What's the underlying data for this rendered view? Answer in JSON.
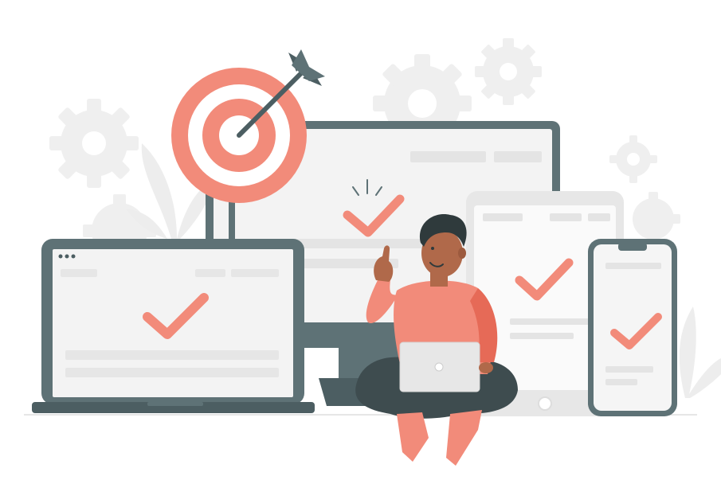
{
  "illustration": {
    "subject": "responsive-design-success",
    "colors": {
      "accent": "#F28B7A",
      "accent_dark": "#E66A57",
      "device_frame": "#5E7276",
      "device_frame_dark": "#4C5E62",
      "screen": "#F3F3F3",
      "screen_line": "#E4E4E4",
      "background_shape": "#EEEEEE",
      "skin": "#B0694A",
      "hair": "#2F3A3C",
      "pants": "#3E4C4F",
      "white": "#FFFFFF"
    },
    "icons": [
      "target-icon",
      "arrow-icon",
      "check-icon",
      "gear-icon",
      "plant-icon"
    ]
  }
}
